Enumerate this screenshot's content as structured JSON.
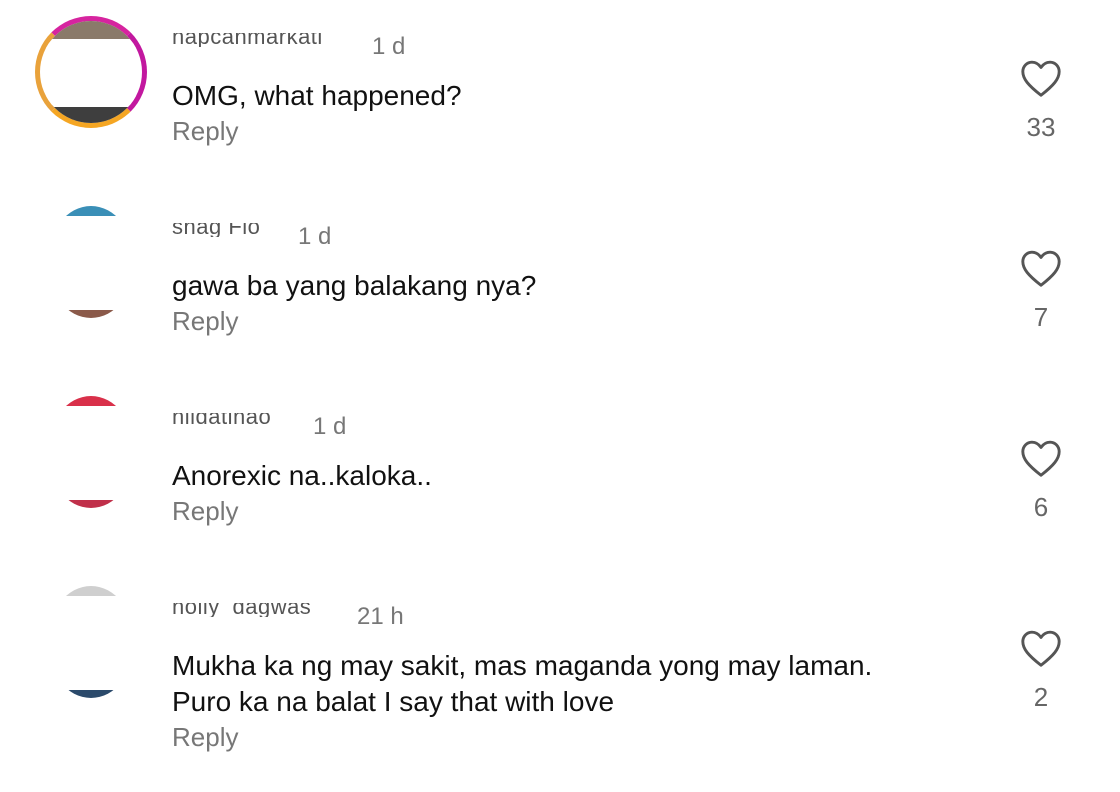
{
  "comments": [
    {
      "username": "hapcanmarkati",
      "time": "1 d",
      "text": "OMG, what happened?",
      "reply_label": "Reply",
      "likes": "33",
      "avatar_style": "story-ring",
      "avatar_colors": [
        "#d6249f",
        "#f5a623"
      ]
    },
    {
      "username": "shag Flo",
      "time": "1 d",
      "text": "gawa ba yang balakang nya?",
      "reply_label": "Reply",
      "likes": "7",
      "avatar_colors": [
        "#3a8fb7",
        "#8b5a4a"
      ]
    },
    {
      "username": "hildatinao",
      "time": "1 d",
      "text": "Anorexic na..kaloka..",
      "reply_label": "Reply",
      "likes": "6",
      "avatar_colors": [
        "#d9304a",
        "#c0304a"
      ]
    },
    {
      "username": "nolly_dagwas",
      "time": "21 h",
      "text_lines": [
        "Mukha ka ng may sakit, mas maganda yong may laman.",
        "Puro ka na balat I say that with love"
      ],
      "reply_label": "Reply",
      "likes": "2",
      "avatar_colors": [
        "#cfcfcf",
        "#2b4a6b"
      ]
    }
  ],
  "icons": {
    "like": "heart-outline-icon"
  }
}
